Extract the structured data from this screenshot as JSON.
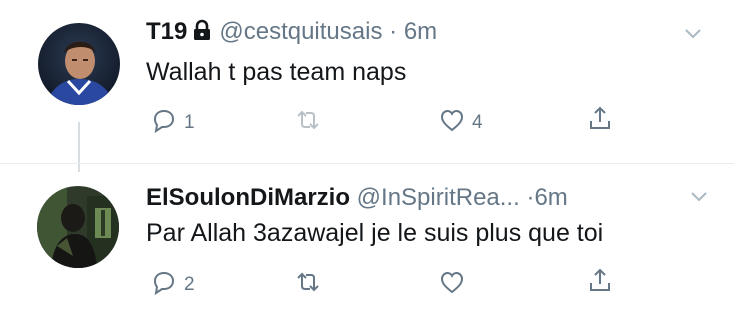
{
  "tweets": [
    {
      "display_name": "T19",
      "protected_icon": "lock-icon",
      "handle": "@cestquitusais",
      "separator": "·",
      "time": "6m",
      "text": "Wallah t pas team naps",
      "reply_count": "1",
      "retweet_count": "",
      "like_count": "4",
      "retweet_disabled": true
    },
    {
      "display_name": "ElSoulonDiMarzio",
      "handle": "@InSpiritRea...",
      "separator": "·",
      "time": "6m",
      "text": "Par Allah 3azawajel je le suis plus que toi",
      "reply_count": "2",
      "retweet_count": "",
      "like_count": ""
    }
  ],
  "icons": [
    "reply-icon",
    "retweet-icon",
    "heart-icon",
    "share-icon",
    "chevron-down-icon",
    "lock-icon"
  ],
  "colors": {
    "text_primary": "#14171a",
    "text_secondary": "#657786",
    "divider": "#e6ecf0",
    "background": "#ffffff"
  }
}
